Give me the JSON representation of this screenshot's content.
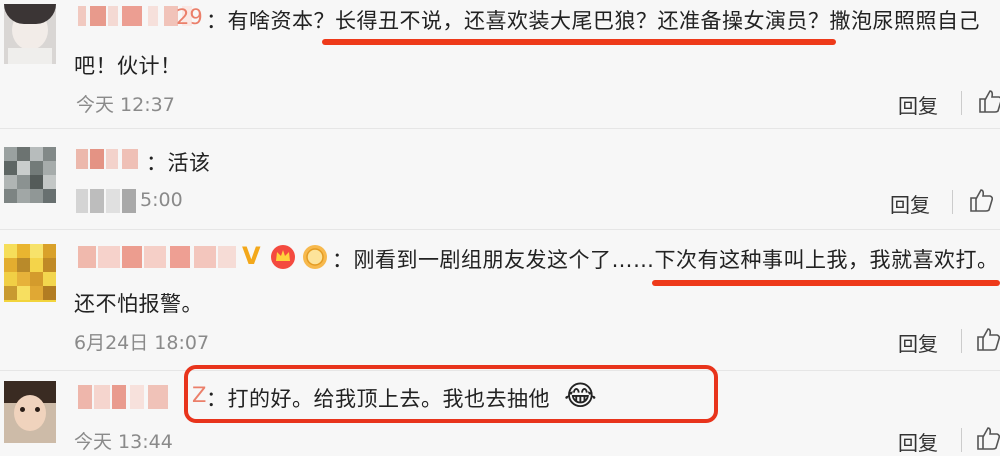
{
  "comments": [
    {
      "name_suffix": "29",
      "text": "：有啥资本？长得丑不说，还喜欢装大尾巴狼？还准备操女演员？撒泡尿照照自己",
      "text_cont": "吧！伙计！",
      "time": "今天 12:37",
      "reply_label": "回复"
    },
    {
      "text": "：活该",
      "time": "5:00",
      "reply_label": "回复"
    },
    {
      "text": "：刚看到一剧组朋友发这个了……下次有这种事叫上我，我就喜欢打。",
      "text_cont": "还不怕报警。",
      "time": "6月24日 18:07",
      "reply_label": "回复",
      "badge_v": "V"
    },
    {
      "name_suffix": "Z",
      "text": "：打的好。给我顶上去。我也去抽他",
      "emoji": "😂",
      "time": "今天 13:44",
      "reply_label": "回复"
    }
  ],
  "icons": {
    "like": "thumbs-up-icon",
    "emoji": "laughing-crying-emoji-icon",
    "v_badge": "verified-v-icon",
    "crown": "crown-badge-icon",
    "medal": "medal-badge-icon"
  },
  "colors": {
    "highlight": "#ee3a1a",
    "background": "#f7f7f7",
    "meta": "#8a8a8a"
  }
}
